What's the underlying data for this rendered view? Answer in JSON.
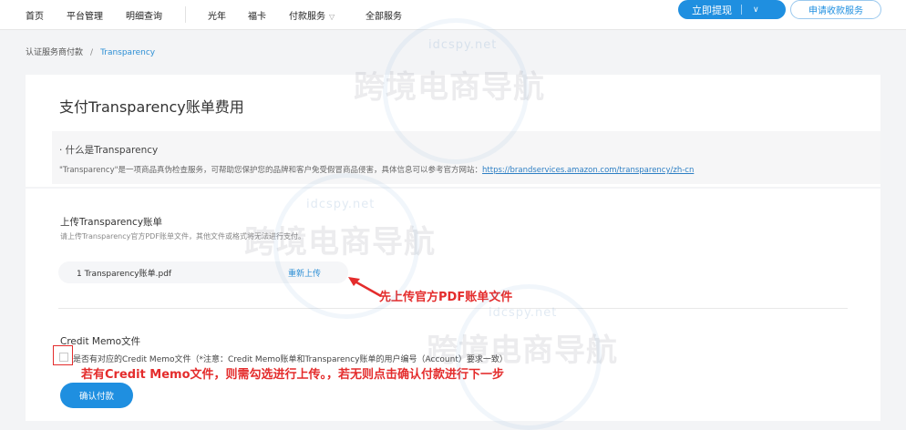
{
  "nav": {
    "items": [
      "首页",
      "平台管理",
      "明细查询",
      "光年",
      "福卡",
      "付款服务",
      "全部服务"
    ],
    "withdraw_label": "立即提现",
    "apply_label": "申请收款服务"
  },
  "breadcrumb": {
    "parent": "认证服务商付款",
    "separator": "/",
    "current": "Transparency"
  },
  "page": {
    "title": "支付Transparency账单费用"
  },
  "info": {
    "title": "· 什么是Transparency",
    "text": "\"Transparency\"是一项商品真伪检查服务，可帮助您保护您的品牌和客户免受假冒商品侵害，具体信息可以参考官方网站：",
    "link": "https://brandservices.amazon.com/transparency/zh-cn"
  },
  "upload": {
    "title": "上传Transparency账单",
    "desc": "请上传Transparency官方PDF账单文件，其他文件或格式将无法进行支付。",
    "file_name": "1 Transparency账单.pdf",
    "reupload_label": "重新上传"
  },
  "credit_memo": {
    "title": "Credit Memo文件",
    "checkbox_label": "是否有对应的Credit Memo文件（*注意：Credit Memo账单和Transparency账单的用户编号（Account）要求一致）",
    "checked": false
  },
  "confirm_label": "确认付款",
  "annotations": {
    "upload_note": "先上传官方PDF账单文件",
    "credit_note": "若有Credit Memo文件，则需勾选进行上传。，若无则点击确认付款进行下一步"
  },
  "watermark": {
    "text": "跨境电商导航",
    "sub": "idcspy.net"
  },
  "colors": {
    "accent": "#1f8fe0",
    "link": "#2d8fd5",
    "annotation": "#e42c2c",
    "background": "#f3f4f6"
  }
}
